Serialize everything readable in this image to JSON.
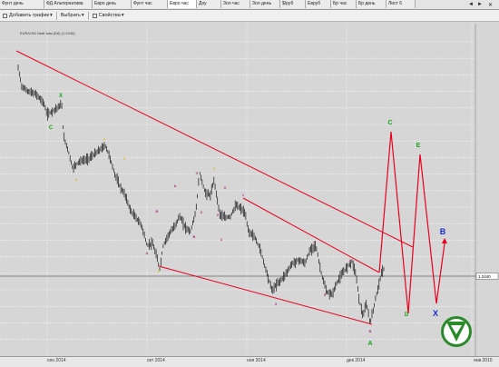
{
  "tabs": [
    "Фунт день",
    "ФД Альтернатива",
    "Евро день",
    "Фунт час",
    "Евро час",
    "Доу",
    "Зол час",
    "Зол день",
    "$/руб",
    "Евруб",
    "Бр час",
    "Бр день",
    "Лист 6"
  ],
  "active_tab": 4,
  "toolbar": {
    "add_chart": "Добавить график",
    "select": "Выбрать",
    "properties": "Свойства"
  },
  "chart": {
    "symbol_label": "EUR/USD Нмй 1мм (Бб) (1.2440)",
    "price_tag": "1.2440",
    "x_labels": [
      "сен 2014",
      "окт 2014",
      "ноя 2014",
      "дек 2014",
      "янв 2015"
    ],
    "wave_labels": [
      "X",
      "C",
      "X",
      "Y",
      "Y",
      "A",
      "B",
      "C",
      "A",
      "B",
      "X",
      "Y",
      "X",
      "Z",
      "X",
      "1",
      "2",
      "3",
      "4",
      "5",
      "A",
      "B",
      "C",
      "D",
      "E",
      "A",
      "B"
    ],
    "colors": {
      "trend": "#e8001c",
      "forecast": "#e8001c",
      "green_label": "#1aa21a",
      "blue_label": "#1a2ae0",
      "purple_label": "#aa2f7a",
      "yellow_label": "#d8c000",
      "candle": "#111111"
    }
  }
}
